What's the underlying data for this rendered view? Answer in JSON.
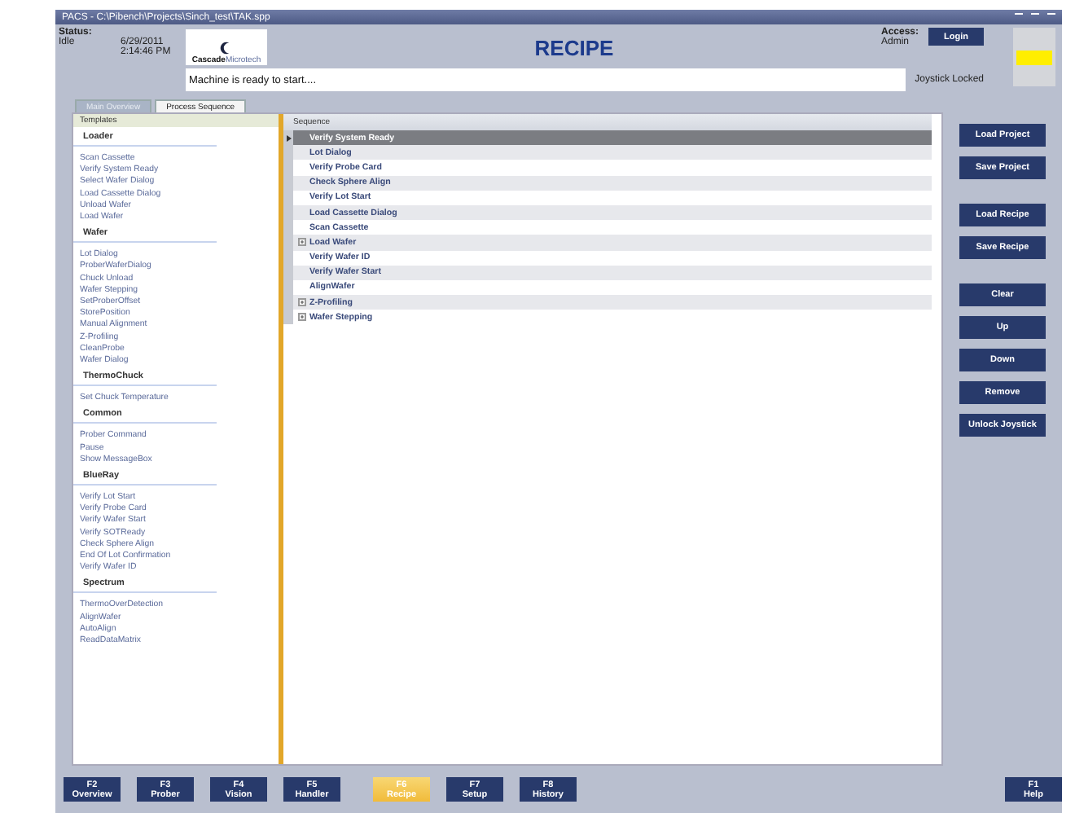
{
  "window": {
    "title": "PACS - C:\\Pibench\\Projects\\Sinch_test\\TAK.spp"
  },
  "status": {
    "label": "Status:",
    "value": "Idle",
    "date": "6/29/2011",
    "time": "2:14:46 PM"
  },
  "logo": {
    "text": "Cascade",
    "subtext": "Microtech"
  },
  "screen_title": "RECIPE",
  "access": {
    "label": "Access:",
    "value": "Admin",
    "button": "Login"
  },
  "message": "Machine is ready to start....",
  "joystick_status": "Joystick Locked",
  "indicator": {
    "color": "#ffee00"
  },
  "tabs": [
    {
      "label": "Main Overview",
      "selected": false
    },
    {
      "label": "Process Sequence",
      "selected": true
    }
  ],
  "templates": {
    "header": "Templates",
    "groups": [
      {
        "title": "Loader",
        "items": [
          "Scan Cassette",
          "Verify System Ready",
          "Select Wafer Dialog",
          "Load Cassette Dialog",
          "Unload Wafer",
          "Load Wafer"
        ]
      },
      {
        "title": "Wafer",
        "items": [
          "Lot Dialog",
          "ProberWaferDialog",
          "Chuck Unload",
          "Wafer Stepping",
          "SetProberOffset",
          "StorePosition",
          "Manual Alignment",
          "Z-Profiling",
          "CleanProbe",
          "Wafer Dialog"
        ]
      },
      {
        "title": "ThermoChuck",
        "items": [
          "Set Chuck Temperature"
        ]
      },
      {
        "title": "Common",
        "items": [
          "Prober Command",
          "Pause",
          "Show MessageBox"
        ]
      },
      {
        "title": "BlueRay",
        "items": [
          "Verify Lot Start",
          "Verify Probe Card",
          "Verify Wafer Start",
          "Verify SOTReady",
          "Check Sphere Align",
          "End Of Lot Confirmation",
          "Verify Wafer ID"
        ]
      },
      {
        "title": "Spectrum",
        "items": [
          "ThermoOverDetection",
          "AlignWafer",
          "AutoAlign",
          "ReadDataMatrix"
        ]
      }
    ]
  },
  "sequence": {
    "header": "Sequence",
    "rows": [
      {
        "label": "Verify System Ready",
        "selected": true,
        "expandable": false
      },
      {
        "label": "Lot Dialog",
        "selected": false,
        "expandable": false
      },
      {
        "label": "Verify Probe Card",
        "selected": false,
        "expandable": false
      },
      {
        "label": "Check Sphere Align",
        "selected": false,
        "expandable": false
      },
      {
        "label": "Verify Lot Start",
        "selected": false,
        "expandable": false
      },
      {
        "label": "Load Cassette Dialog",
        "selected": false,
        "expandable": false
      },
      {
        "label": "Scan Cassette",
        "selected": false,
        "expandable": false
      },
      {
        "label": "Load Wafer",
        "selected": false,
        "expandable": true
      },
      {
        "label": "Verify Wafer ID",
        "selected": false,
        "expandable": false
      },
      {
        "label": "Verify Wafer Start",
        "selected": false,
        "expandable": false
      },
      {
        "label": "AlignWafer",
        "selected": false,
        "expandable": false
      },
      {
        "label": "Z-Profiling",
        "selected": false,
        "expandable": true
      },
      {
        "label": "Wafer Stepping",
        "selected": false,
        "expandable": true
      }
    ]
  },
  "side_buttons": [
    [
      "Load Project",
      "Save Project"
    ],
    [
      "Load Recipe",
      "Save Recipe"
    ],
    [
      "Clear",
      "Up",
      "Down",
      "Remove",
      "Unlock Joystick"
    ]
  ],
  "function_keys": [
    {
      "key": "F2",
      "label": "Overview",
      "selected": false
    },
    {
      "key": "F3",
      "label": "Prober",
      "selected": false
    },
    {
      "key": "F4",
      "label": "Vision",
      "selected": false
    },
    {
      "key": "F5",
      "label": "Handler",
      "selected": false
    },
    {
      "key": "F6",
      "label": "Recipe",
      "selected": true
    },
    {
      "key": "F7",
      "label": "Setup",
      "selected": false
    },
    {
      "key": "F8",
      "label": "History",
      "selected": false
    }
  ],
  "help_key": {
    "key": "F1",
    "label": "Help"
  }
}
